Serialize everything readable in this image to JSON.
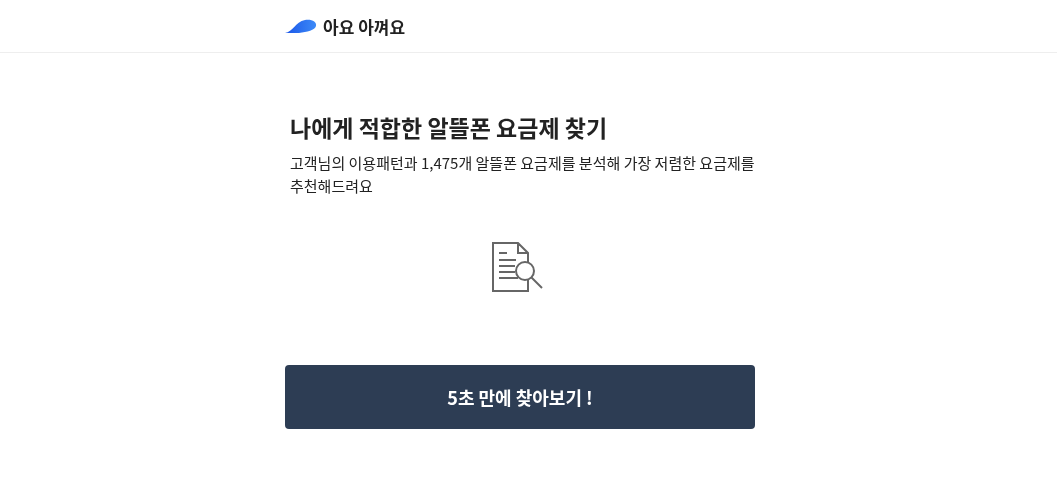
{
  "header": {
    "logo_text": "아요 아껴요"
  },
  "title": "나에게 적합한 알뜰폰 요금제 찾기",
  "description": "고객님의 이용패턴과 1,475개 알뜰폰 요금제를 분석해 가장 저렴한 요금제를 추천해드려요",
  "start_button": "5초 만에 찾아보기 !"
}
